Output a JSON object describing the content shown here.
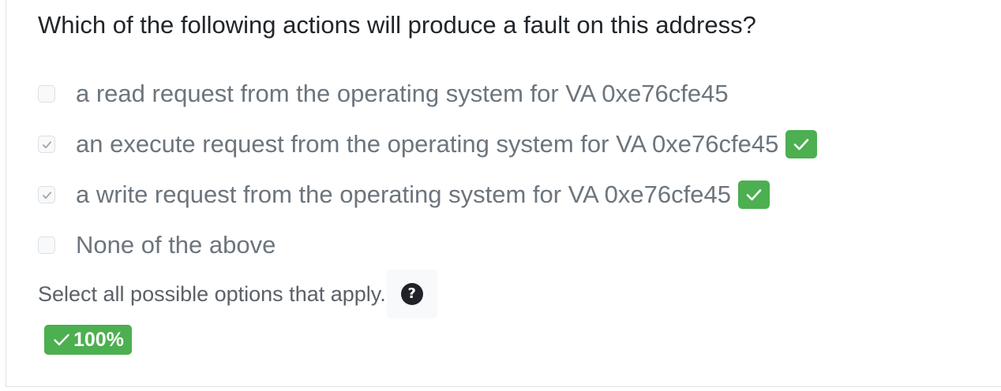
{
  "question": {
    "text": "Which of the following actions will produce a fault on this address?"
  },
  "options": [
    {
      "label": "a read request from the operating system for VA 0xe76cfe45",
      "checked": false,
      "marked_correct": false
    },
    {
      "label": "an execute request from the operating system for VA 0xe76cfe45",
      "checked": true,
      "marked_correct": true
    },
    {
      "label": "a write request from the operating system for VA 0xe76cfe45",
      "checked": true,
      "marked_correct": true
    },
    {
      "label": "None of the above",
      "checked": false,
      "marked_correct": false
    }
  ],
  "hint": {
    "text": "Select all possible options that apply.",
    "help_icon": "question-circle-icon"
  },
  "score": {
    "icon": "check-icon",
    "text": "100%"
  },
  "colors": {
    "correct_green": "#4caf50",
    "option_text": "#6c757d",
    "question_text": "#212529"
  }
}
